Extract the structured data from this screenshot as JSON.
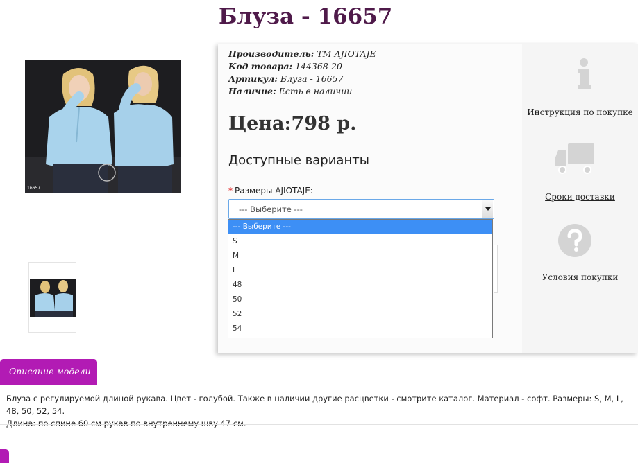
{
  "product": {
    "title": "Блуза - 16657",
    "photo_code": "16657",
    "manufacturer_label": "Производитель:",
    "manufacturer_value": "ТМ AJIOTAJE",
    "code_label": "Код товара:",
    "code_value": "144368-20",
    "article_label": "Артикул:",
    "article_value": "Блуза - 16657",
    "stock_label": "Наличие:",
    "stock_value": "Есть в наличии",
    "price": "Цена:798 р."
  },
  "variants": {
    "title": "Доступные варианты",
    "required_mark": "*",
    "size_label": "Размеры AJIOTAJE:",
    "selected": "--- Выберите ---",
    "options": [
      "--- Выберите ---",
      "S",
      "M",
      "L",
      "48",
      "50",
      "52",
      "54"
    ]
  },
  "sidebar": {
    "instruction": "Инструкция по покупке",
    "delivery": "Сроки доставки",
    "conditions": "Условия покупки"
  },
  "description": {
    "tab_label": "Описание модели",
    "line1": "Блуза с регулируемой длиной рукава. Цвет - голубой. Также в наличии другие расцветки - смотрите каталог. Материал - софт. Размеры: S, M, L, 48, 50, 52, 54.",
    "line2": "Длина: по спине 60 см рукав по внутреннему шву 47 см."
  },
  "colors": {
    "title": "#4f1a4a",
    "accent": "#b21bb4",
    "selected_option": "#3d8ff5",
    "icon_gray": "#d4d4d4",
    "blouse": "#a9d3ec"
  },
  "icons": [
    "info-icon",
    "truck-icon",
    "question-icon",
    "dropdown-arrow-icon"
  ]
}
